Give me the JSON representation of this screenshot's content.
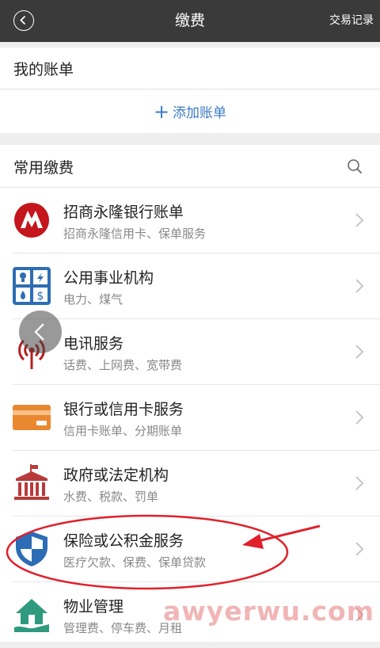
{
  "header": {
    "title": "缴费",
    "history_label": "交易记录"
  },
  "bills": {
    "title": "我的账单",
    "add_label": "添加账单"
  },
  "common": {
    "title": "常用缴费",
    "items": [
      {
        "name": "招商永隆银行账单",
        "desc": "招商永隆信用卡、保单服务",
        "icon": "cmb-logo-icon"
      },
      {
        "name": "公用事业机构",
        "desc": "电力、煤气",
        "icon": "utility-icon"
      },
      {
        "name": "电讯服务",
        "desc": "话费、上网费、宽带费",
        "icon": "telecom-tower-icon"
      },
      {
        "name": "银行或信用卡服务",
        "desc": "信用卡账单、分期账单",
        "icon": "bank-card-icon"
      },
      {
        "name": "政府或法定机构",
        "desc": "水费、税款、罚单",
        "icon": "government-building-icon"
      },
      {
        "name": "保险或公积金服务",
        "desc": "医疗欠款、保费、保单贷款",
        "icon": "shield-icon"
      },
      {
        "name": "物业管理",
        "desc": "管理费、停车费、月租",
        "icon": "property-house-icon"
      }
    ]
  },
  "watermark": "awyerwu.com",
  "colors": {
    "header_bg": "#3a3a3a",
    "accent_blue": "#3c7bc6",
    "annotation_red": "#e0202a"
  }
}
